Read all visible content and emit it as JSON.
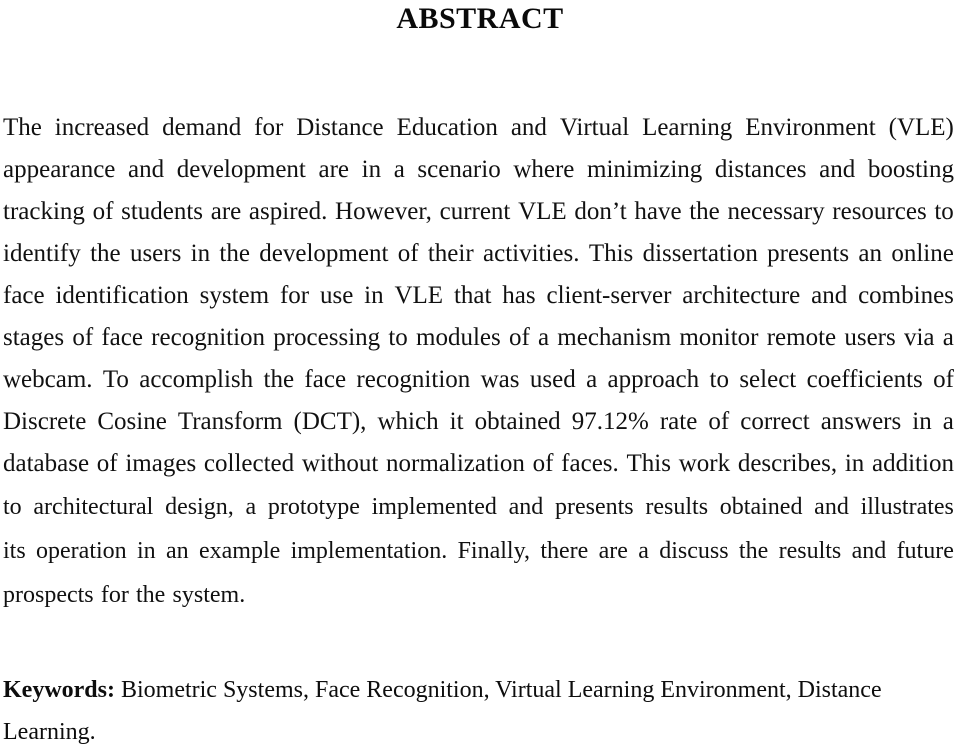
{
  "document": {
    "heading": "ABSTRACT",
    "paragraph_1": {
      "full_text": "The increased demand for Distance Education and Virtual Learning Environment (VLE) appearance and development are in a scenario where minimizing distances and boosting tracking of students are aspired. However, current VLE don’t have the necessary resources to identify the users in the development of their activities. This dissertation presents an online face identification system for use in VLE that has client-server architecture and combines stages of face recognition processing to modules of a mechanism monitor remote users via a webcam. To accomplish the face recognition was used a approach to select coefficients of Discrete Cosine Transform (DCT), which it obtained 97.12% rate of correct answers in a database of images collected without normalization of faces. This work describes, in addition to architectural design, a prototype implemented and presents results obtained and illustrates its operation in an example implementation. Finally, there are a discuss the results and future prospects for the system.",
      "lines": [
        {
          "text": "The increased demand for Distance Education and Virtual Learning Environment (VLE)",
          "justified": true
        },
        {
          "text": "appearance and development are in a scenario where minimizing distances and boosting",
          "justified": true
        },
        {
          "text": "tracking of students are aspired. However, current VLE don’t have the necessary resources to",
          "justified": true
        },
        {
          "text": "identify the users in the development of their activities. This dissertation presents an online",
          "justified": true
        },
        {
          "text": "face identification system for use in VLE that has client-server architecture and combines",
          "justified": true
        },
        {
          "text": "stages of face recognition processing to modules of a mechanism monitor remote users via a",
          "justified": true
        },
        {
          "text": "webcam. To accomplish the face recognition was used a approach to select coefficients of",
          "justified": true
        },
        {
          "text": "Discrete Cosine Transform (DCT), which it obtained 97.12% rate of correct answers in a",
          "justified": true
        },
        {
          "text": "database of images collected without normalization of faces. This work describes, in addition",
          "justified": true
        },
        {
          "text": "to architectural design, a prototype implemented and presents results obtained and illustrates",
          "justified": true
        },
        {
          "text": "its operation in an example implementation. Finally, there are a discuss the results and future",
          "justified": true
        },
        {
          "text": "prospects for the system.",
          "justified": false
        }
      ]
    },
    "keywords": {
      "label": "Keywords:",
      "values_line_1": "Biometric Systems, Face Recognition, Virtual Learning Environment, Distance",
      "values_line_2": "Learning.",
      "terms": [
        "Biometric Systems",
        "Face Recognition",
        "Virtual Learning Environment",
        "Distance Learning"
      ]
    },
    "statistics": {
      "accuracy_rate": "97.12%"
    },
    "colors": {
      "page_background": "#ffffff",
      "text": "#111111",
      "heading": "#0a0a0a"
    }
  }
}
